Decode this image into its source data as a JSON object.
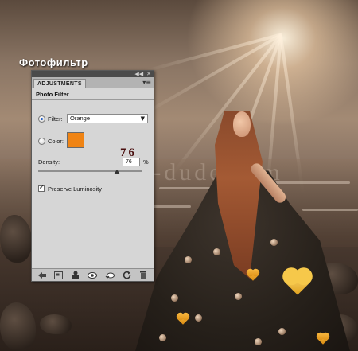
{
  "caption": {
    "title": "Фотофильтр"
  },
  "watermark": {
    "text": "www.psd-dude.com"
  },
  "overlay": {
    "density_value": "76"
  },
  "panel": {
    "tab": "ADJUSTMENTS",
    "title": "Photo Filter",
    "filter_label": "Filter:",
    "filter_value": "Orange",
    "filter_selected": true,
    "color_label": "Color:",
    "color_value": "#f08414",
    "density_label": "Density:",
    "density_value": "76",
    "density_unit": "%",
    "density_fraction": 0.76,
    "preserve_label": "Preserve Luminosity",
    "preserve_checked": true,
    "bottom_icons": [
      "back-icon",
      "expand-icon",
      "clip-layer-icon",
      "visibility-icon",
      "view-previous-icon",
      "reset-icon",
      "delete-icon"
    ]
  }
}
